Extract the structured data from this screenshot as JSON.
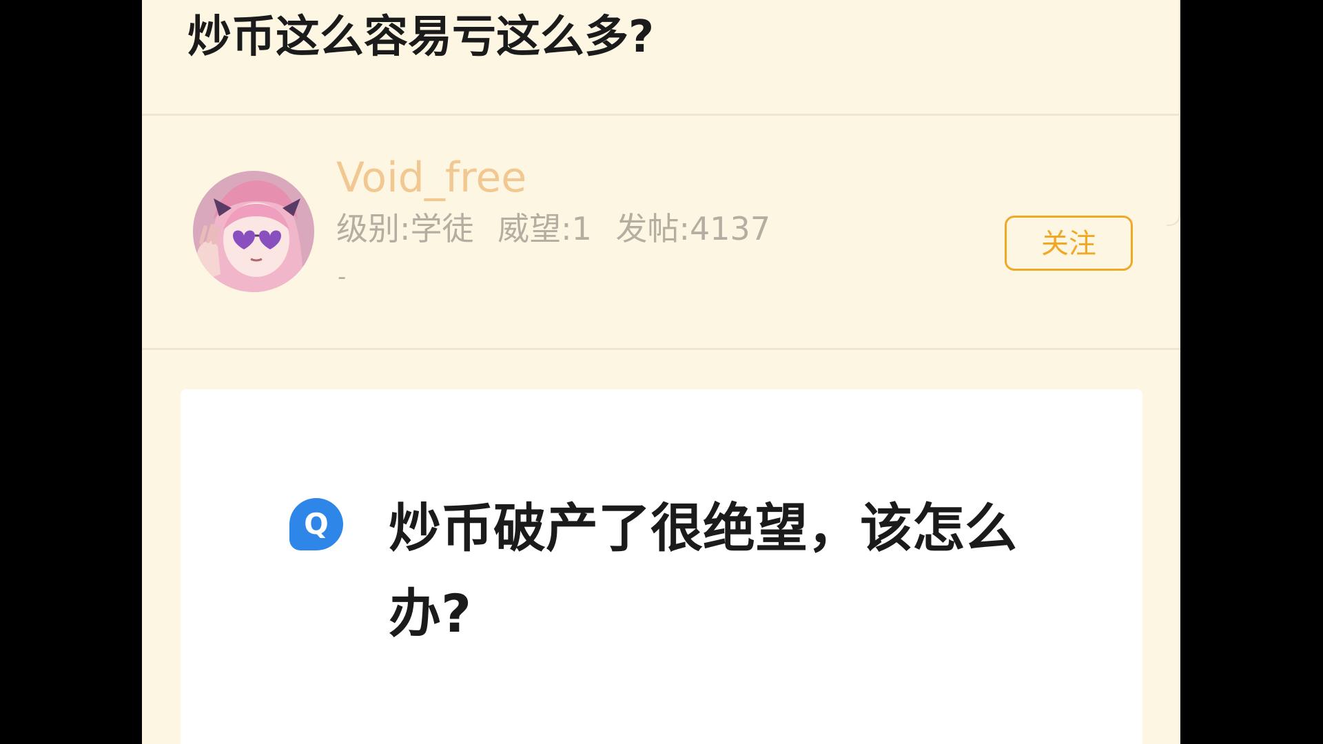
{
  "post": {
    "title": "炒币这么容易亏这么多?"
  },
  "author": {
    "username": "Void_free",
    "level": "级别:学徒",
    "reputation": "威望:1",
    "posts": "发帖:4137",
    "signature": "-",
    "follow_label": "关注",
    "avatar_icon": "anime-avatar-icon"
  },
  "content": {
    "badge_label": "Q",
    "question": "炒币破产了很绝望，该怎么办?"
  },
  "colors": {
    "page_background": "#fdf6e3",
    "username": "#f2c892",
    "accent": "#f0a826",
    "badge": "#2f86e9"
  }
}
